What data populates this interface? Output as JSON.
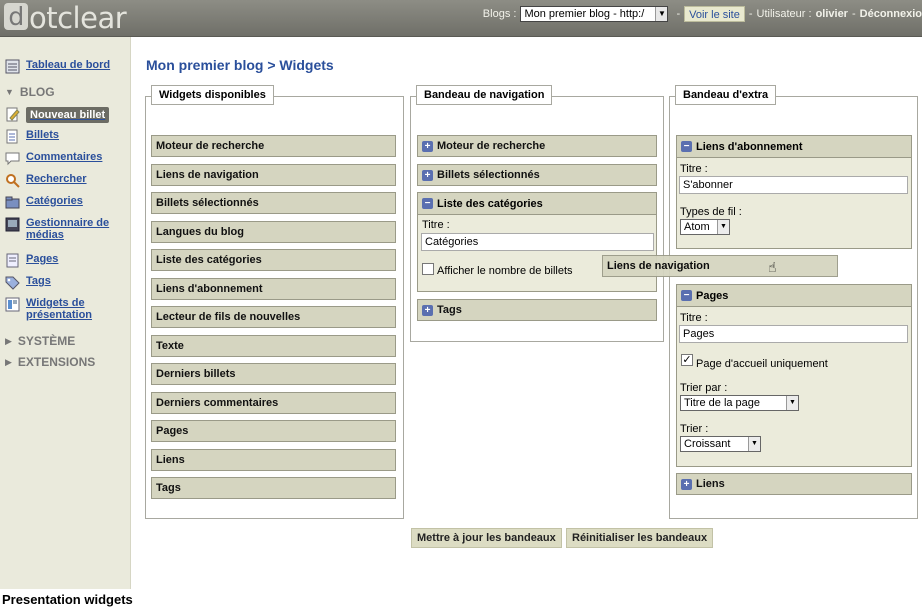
{
  "header": {
    "logo_text": "otclear",
    "logo_letter": "d",
    "blogs_label": "Blogs :",
    "blog_select_value": "Mon premier blog - http:/",
    "separator": "-",
    "view_site": "Voir le site",
    "user_label": "Utilisateur :",
    "user_name": "olivier",
    "logout": "Déconnexio"
  },
  "sidebar": {
    "dashboard": "Tableau de bord",
    "blog_section": "BLOG",
    "items": [
      {
        "label": "Nouveau billet",
        "icon": "new-post-icon"
      },
      {
        "label": "Billets",
        "icon": "posts-icon"
      },
      {
        "label": "Commentaires",
        "icon": "comments-icon"
      },
      {
        "label": "Rechercher",
        "icon": "search-icon"
      },
      {
        "label": "Catégories",
        "icon": "categories-icon"
      },
      {
        "label_line1": "Gestionnaire de",
        "label_line2": "médias",
        "icon": "media-icon"
      },
      {
        "label": "Pages",
        "icon": "pages-icon"
      },
      {
        "label": "Tags",
        "icon": "tags-icon"
      },
      {
        "label_line1": "Widgets de",
        "label_line2": "présentation",
        "icon": "widgets-icon"
      }
    ],
    "system_section": "SYSTÈME",
    "extensions_section": "EXTENSIONS"
  },
  "main": {
    "title": "Mon premier blog > Widgets",
    "available": {
      "legend": "Widgets disponibles",
      "widgets": [
        "Moteur de recherche",
        "Liens de navigation",
        "Billets sélectionnés",
        "Langues du blog",
        "Liste des catégories",
        "Liens d'abonnement",
        "Lecteur de fils de nouvelles",
        "Texte",
        "Derniers billets",
        "Derniers commentaires",
        "Pages",
        "Liens",
        "Tags"
      ]
    },
    "nav": {
      "legend": "Bandeau de navigation",
      "w1": "Moteur de recherche",
      "w2": "Billets sélectionnés",
      "w3": "Liste des catégories",
      "w3_title_label": "Titre :",
      "w3_title_value": "Catégories",
      "w3_checkbox_label": "Afficher le nombre de billets",
      "w4": "Tags"
    },
    "extra": {
      "legend": "Bandeau d'extra",
      "w1": "Liens d'abonnement",
      "w1_title_label": "Titre :",
      "w1_title_value": "S'abonner",
      "w1_feed_label": "Types de fil :",
      "w1_feed_value": "Atom",
      "w2": "Pages",
      "w2_title_label": "Titre :",
      "w2_title_value": "Pages",
      "w2_checkbox_label": "Page d'accueil uniquement",
      "w2_sort_by_label": "Trier par :",
      "w2_sort_by_value": "Titre de la page",
      "w2_order_label": "Trier :",
      "w2_order_value": "Croissant",
      "w3": "Liens"
    },
    "dragging": "Liens de navigation",
    "buttons": {
      "update": "Mettre à jour les bandeaux",
      "reset": "Réinitialiser les bandeaux"
    }
  },
  "caption": "Presentation widgets"
}
